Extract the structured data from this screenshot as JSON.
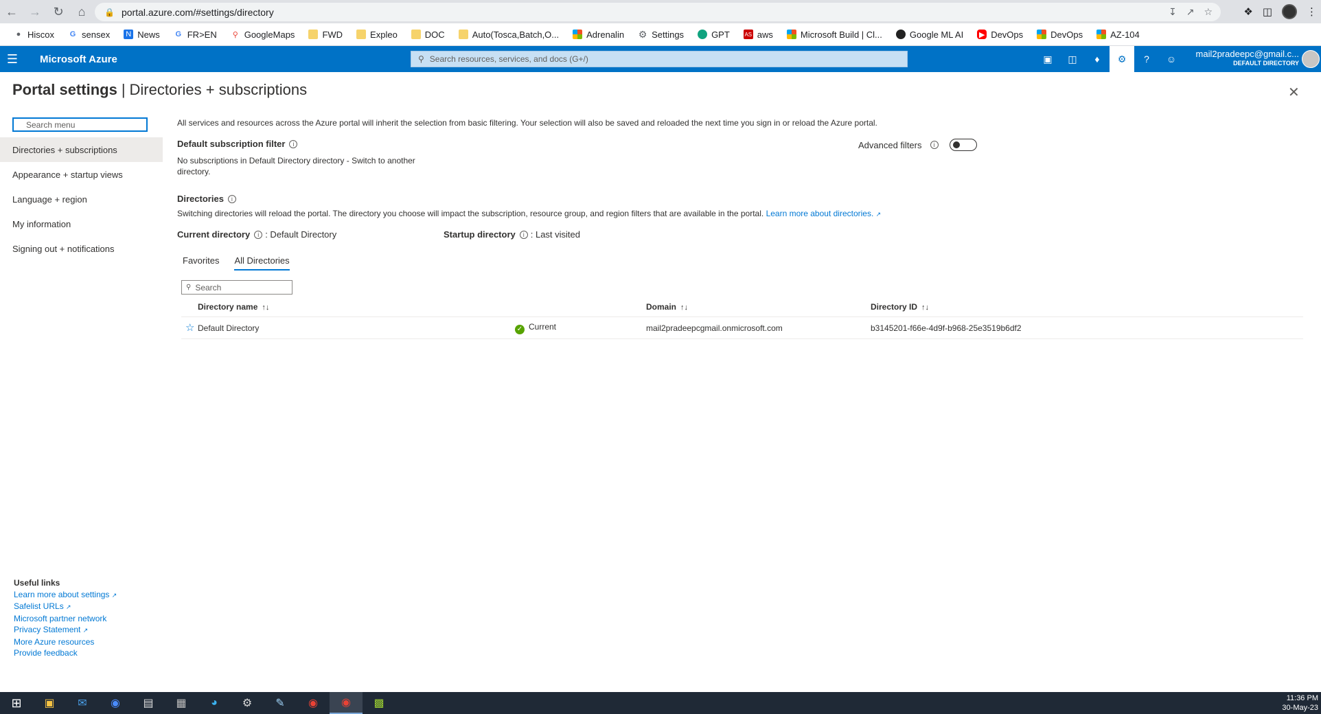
{
  "browser": {
    "url": "portal.azure.com/#settings/directory",
    "bookmarks": [
      {
        "label": "Hiscox",
        "icon": "hiscox-icon"
      },
      {
        "label": "sensex",
        "icon": "google-icon"
      },
      {
        "label": "News",
        "icon": "news-icon"
      },
      {
        "label": "FR>EN",
        "icon": "google-icon"
      },
      {
        "label": "GoogleMaps",
        "icon": "maps-icon"
      },
      {
        "label": "FWD",
        "icon": "folder-icon"
      },
      {
        "label": "Expleo",
        "icon": "folder-icon"
      },
      {
        "label": "DOC",
        "icon": "folder-icon"
      },
      {
        "label": "Auto(Tosca,Batch,O...",
        "icon": "folder-icon"
      },
      {
        "label": "Adrenalin",
        "icon": "microsoft-icon"
      },
      {
        "label": "Settings",
        "icon": "gear-icon"
      },
      {
        "label": "GPT",
        "icon": "gpt-icon"
      },
      {
        "label": "aws",
        "icon": "aws-icon"
      },
      {
        "label": "Microsoft Build | Cl...",
        "icon": "microsoft-icon"
      },
      {
        "label": "Google ML AI",
        "icon": "ml-icon"
      },
      {
        "label": "DevOps",
        "icon": "youtube-icon"
      },
      {
        "label": "DevOps",
        "icon": "microsoft-icon"
      },
      {
        "label": "AZ-104",
        "icon": "microsoft-icon"
      }
    ]
  },
  "azure": {
    "brand": "Microsoft Azure",
    "search_placeholder": "Search resources, services, and docs (G+/)",
    "account_email": "mail2pradeepc@gmail.c...",
    "account_directory": "DEFAULT DIRECTORY"
  },
  "page": {
    "title": "Portal settings",
    "subtitle": "Directories + subscriptions",
    "separator": "|"
  },
  "menu": {
    "search_placeholder": "Search menu",
    "items": [
      "Directories + subscriptions",
      "Appearance + startup views",
      "Language + region",
      "My information",
      "Signing out + notifications"
    ]
  },
  "useful_links": {
    "heading": "Useful links",
    "links": [
      "Learn more about settings",
      "Safelist URLs",
      "Microsoft partner network",
      "Privacy Statement",
      "More Azure resources",
      "Provide feedback"
    ]
  },
  "content": {
    "intro": "All services and resources across the Azure portal will inherit the selection from basic filtering. Your selection will also be saved and reloaded the next time you sign in or reload the Azure portal.",
    "default_filter_heading": "Default subscription filter",
    "default_filter_text": "No subscriptions in Default Directory directory - Switch to another directory.",
    "advanced_filters_label": "Advanced filters",
    "directories_heading": "Directories",
    "directories_text": "Switching directories will reload the portal. The directory you choose will impact the subscription, resource group, and region filters that are available in the portal.",
    "directories_link": "Learn more about directories.",
    "current_directory_label": "Current directory",
    "current_directory_value": ": Default Directory",
    "startup_directory_label": "Startup directory",
    "startup_directory_value": ": Last visited",
    "tabs": [
      "Favorites",
      "All Directories"
    ],
    "table_search_placeholder": "Search",
    "columns": [
      "Directory name",
      "Domain",
      "Directory ID"
    ],
    "rows": [
      {
        "name": "Default Directory",
        "status": "Current",
        "domain": "mail2pradeepcgmail.onmicrosoft.com",
        "id": "b3145201-f66e-4d9f-b968-25e3519b6df2"
      }
    ]
  },
  "taskbar": {
    "time": "11:36 PM",
    "date": "30-May-23"
  }
}
